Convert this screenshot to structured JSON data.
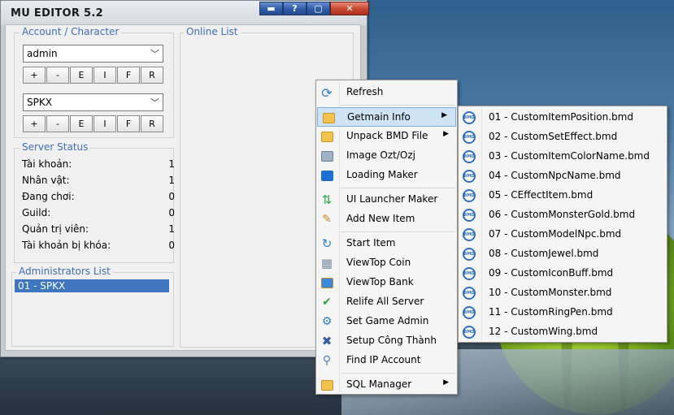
{
  "window": {
    "title": "MU EDITOR 5.2",
    "caption_buttons": {
      "minimize": "▬",
      "help": "?",
      "restore": "▢",
      "close": "✕"
    }
  },
  "account_character": {
    "legend": "Account / Character",
    "account_value": "admin",
    "character_value": "SPKX",
    "buttons": [
      "+",
      "-",
      "E",
      "I",
      "F",
      "R"
    ]
  },
  "online_list": {
    "legend": "Online List"
  },
  "server_status": {
    "legend": "Server Status",
    "rows": [
      {
        "label": "Tài khoản:",
        "value": "1"
      },
      {
        "label": "Nhân vật:",
        "value": "1"
      },
      {
        "label": "Đang chơi:",
        "value": "0"
      },
      {
        "label": "Guild:",
        "value": "0"
      },
      {
        "label": "Quản trị viên:",
        "value": "1"
      },
      {
        "label": "Tài khoản bị khóa:",
        "value": "0"
      }
    ]
  },
  "administrators": {
    "legend": "Administrators List",
    "items": [
      "01 - SPKX"
    ]
  },
  "context_menu": {
    "items": [
      {
        "label": "Refresh",
        "icon": "refresh-icon"
      },
      {
        "label": "Getmain Info",
        "icon": "folder-icon",
        "submenu": true,
        "highlighted": true
      },
      {
        "label": "Unpack BMD File",
        "icon": "bmd-package-icon",
        "submenu": true
      },
      {
        "label": "Image Ozt/Ozj",
        "icon": "image-icon"
      },
      {
        "label": "Loading Maker",
        "icon": "bookmark-icon"
      },
      {
        "label": "UI Launcher Maker",
        "icon": "launcher-icon"
      },
      {
        "label": "Add New Item",
        "icon": "note-icon"
      },
      {
        "label": "Start Item",
        "icon": "cycle-icon"
      },
      {
        "label": "ViewTop Coin",
        "icon": "grid-icon"
      },
      {
        "label": "ViewTop Bank",
        "icon": "briefcase-icon"
      },
      {
        "label": "Relife All Server",
        "icon": "check-icon"
      },
      {
        "label": "Set Game Admin",
        "icon": "admin-icon"
      },
      {
        "label": "Setup Công Thành",
        "icon": "tools-icon"
      },
      {
        "label": "Find IP Account",
        "icon": "search-icon"
      },
      {
        "label": "SQL Manager",
        "icon": "folder-icon",
        "submenu": true
      }
    ]
  },
  "submenu": {
    "items": [
      "01 - CustomItemPosition.bmd",
      "02 - CustomSetEffect.bmd",
      "03 - CustomItemColorName.bmd",
      "04 - CustomNpcName.bmd",
      "05 - CEffectItem.bmd",
      "06 - CustomMonsterGold.bmd",
      "07 - CustomModelNpc.bmd",
      "08 - CustomJewel.bmd",
      "09 - CustomIconBuff.bmd",
      "10 - CustomMonster.bmd",
      "11 - CustomRingPen.bmd",
      "12 - CustomWing.bmd"
    ],
    "icon": "bmd-file-icon"
  },
  "colors": {
    "accent": "#3e76c0",
    "legend": "#3c6eb4",
    "highlight": "#cfe3f7"
  }
}
